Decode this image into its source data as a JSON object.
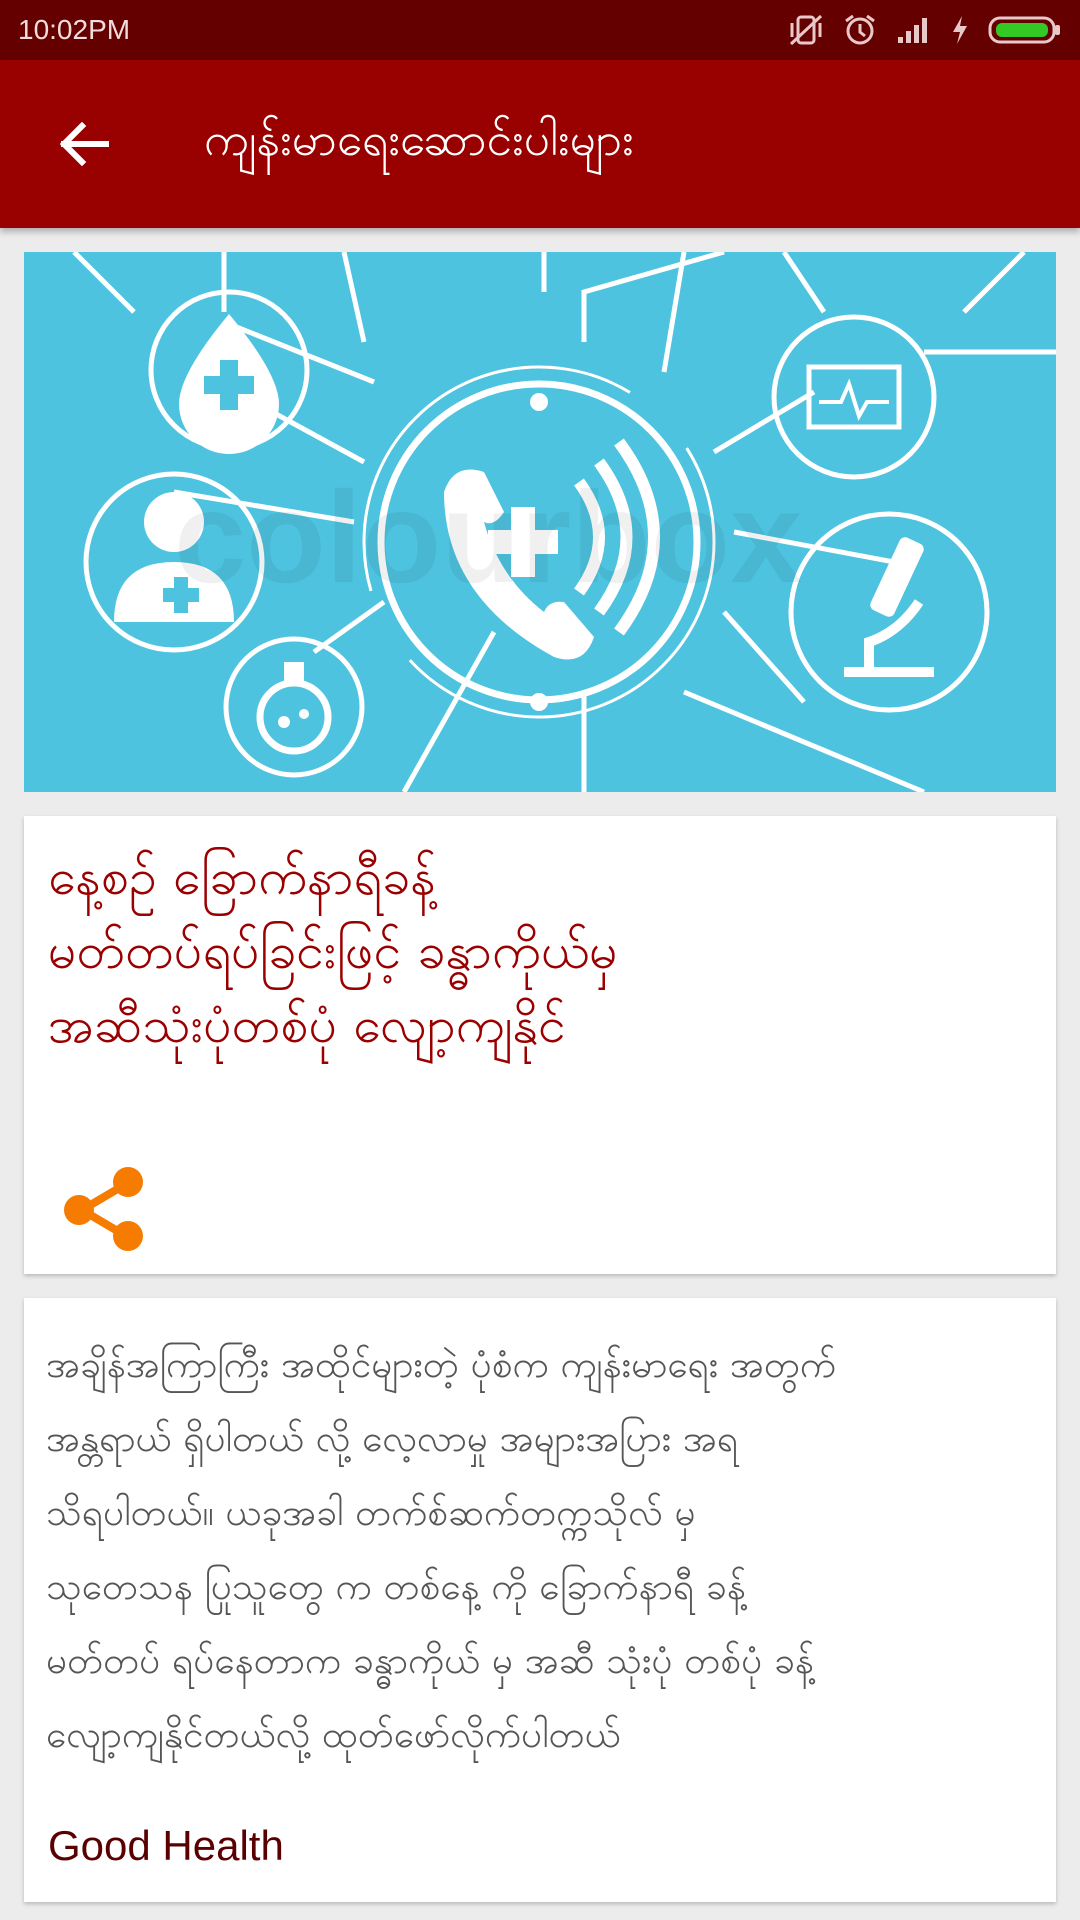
{
  "status_bar": {
    "time": "10:02PM",
    "icons": [
      "vibrate-off-icon",
      "alarm-icon",
      "signal-icon",
      "charging-icon",
      "battery-icon"
    ]
  },
  "app_bar": {
    "back_icon": "arrow-left-icon",
    "title": "ကျန်းမာရေးဆောင်းပါးများ"
  },
  "hero": {
    "watermark": "colourbox",
    "icons": [
      "medical-drop-icon",
      "doctor-icon",
      "flask-icon",
      "phone-cross-icon",
      "monitor-icon",
      "microscope-icon"
    ]
  },
  "article": {
    "headline_lines": [
      "နေ့စဉ် ခြောက်နာရီခန့်",
      "မတ်တပ်ရပ်ခြင်းဖြင့် ခန္ဓာကိုယ်မှ",
      "အဆီသုံးပုံတစ်ပုံ လျော့ကျနိုင်"
    ],
    "share_icon": "share-icon",
    "body_lines": [
      "အချိန်အကြာကြီး အထိုင်များတဲ့ ပုံစံက ကျန်းမာရေး အတွက်",
      "အန္တရာယ် ရှိပါတယ် လို့ လေ့လာမှု အများအပြား အရ",
      "သိရပါတယ်။ ယခုအခါ တက်စ်ဆက်တက္ကသိုလ် မှ",
      "သုတေသန ပြုသူတွေ က တစ်နေ့ ကို ခြောက်နာရီ ခန့်",
      "မတ်တပ် ရပ်နေတာက ခန္ဓာကိုယ် မှ အဆီ သုံးပုံ တစ်ပုံ ခန့်",
      "လျော့ကျနိုင်တယ်လို့ ထုတ်ဖော်လိုက်ပါတယ်"
    ],
    "source": "Good Health"
  },
  "colors": {
    "status_bar": "#640000",
    "app_bar": "#990000",
    "headline": "#9a0000",
    "share": "#f57c00",
    "hero_bg": "#4ec3df"
  }
}
